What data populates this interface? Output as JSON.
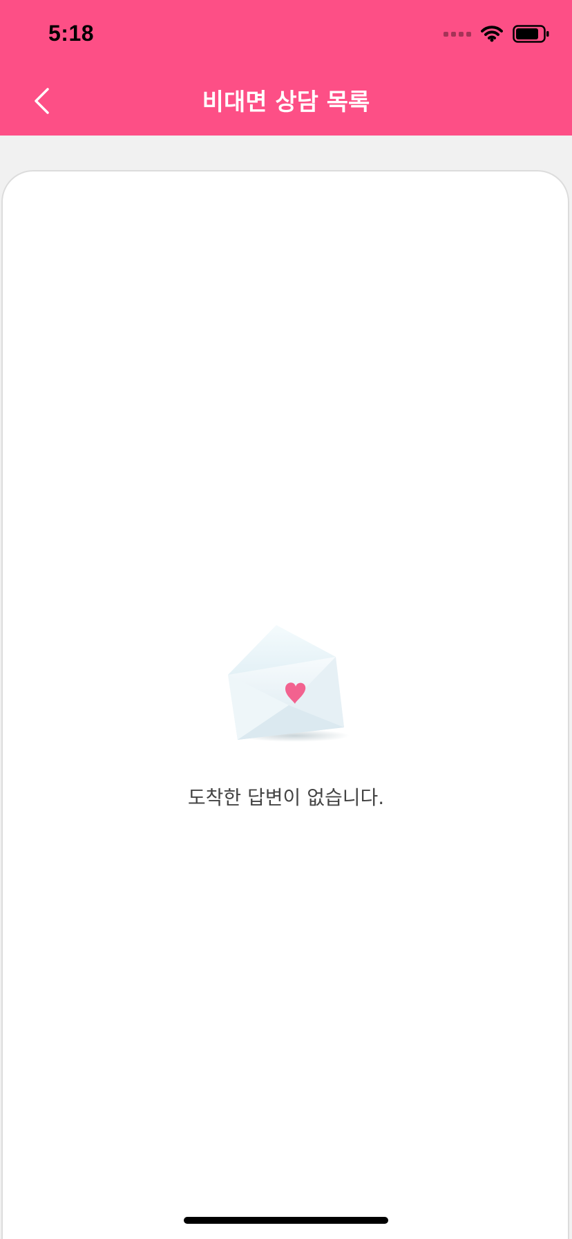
{
  "status_bar": {
    "time": "5:18",
    "icons": [
      "signal-dots-icon",
      "wifi-icon",
      "battery-icon"
    ]
  },
  "nav": {
    "back_icon": "chevron-left-icon",
    "title": "비대면 상담 목록"
  },
  "empty_state": {
    "icon": "open-envelope-heart-icon",
    "message": "도착한 답변이 없습니다."
  },
  "colors": {
    "header": "#fd4f86",
    "background": "#f1f1f1",
    "card": "#ffffff",
    "heart": "#f2628f"
  }
}
